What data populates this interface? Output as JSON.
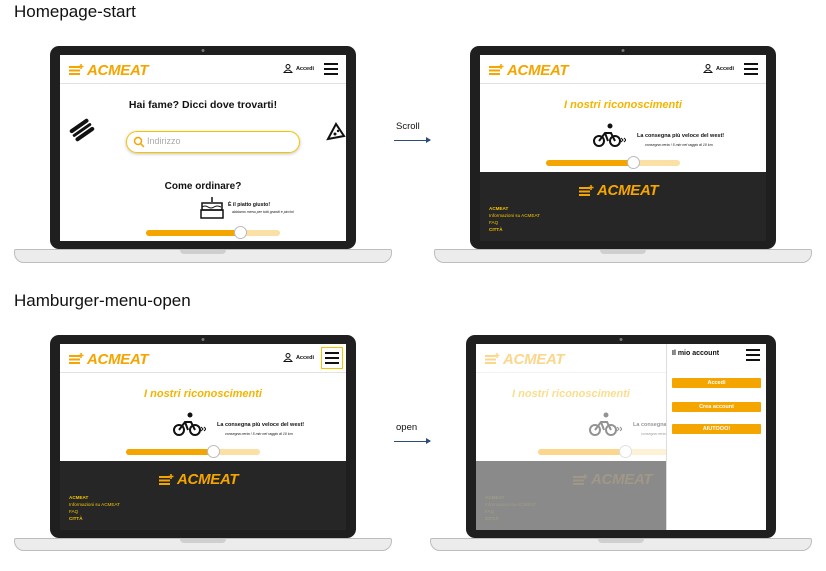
{
  "sections": {
    "top_title": "Homepage-start",
    "bottom_title": "Hamburger-menu-open"
  },
  "arrows": {
    "scroll_label": "Scroll",
    "open_label": "open"
  },
  "app": {
    "logo_text": "ACMEAT",
    "login_label": "Accedi",
    "colors": {
      "accent": "#f5a500",
      "dark": "#262626",
      "highlight": "#f5c400"
    }
  },
  "home": {
    "headline": "Hai fame? Dicci dove trovarti!",
    "search_placeholder": "Indirizzo",
    "how_to_order": "Come ordinare?",
    "step_title": "È il piatto giusto!",
    "step_sub": "abbiamo menu per tutti grandi e piccini",
    "slider_progress": 0.7
  },
  "scrolled": {
    "awards_title": "I nostri riconoscimenti",
    "award_title": "La consegna più veloce del west!",
    "award_sub": "consegna certa ! 5 min nel raggio di 10 km",
    "slider_progress": 0.65,
    "footer_links": [
      "ACMEAT",
      "Informazioni su ACMEAT",
      "FAQ",
      "CITTÀ"
    ]
  },
  "drawer": {
    "title": "Il mio account",
    "buttons": [
      "Accedi",
      "Crea account",
      "AIUTOOO!"
    ]
  },
  "icons": [
    "burger-icon",
    "search-icon",
    "pizza-icon",
    "cake-icon",
    "bike-icon",
    "user-icon",
    "hamburger-menu-icon"
  ]
}
